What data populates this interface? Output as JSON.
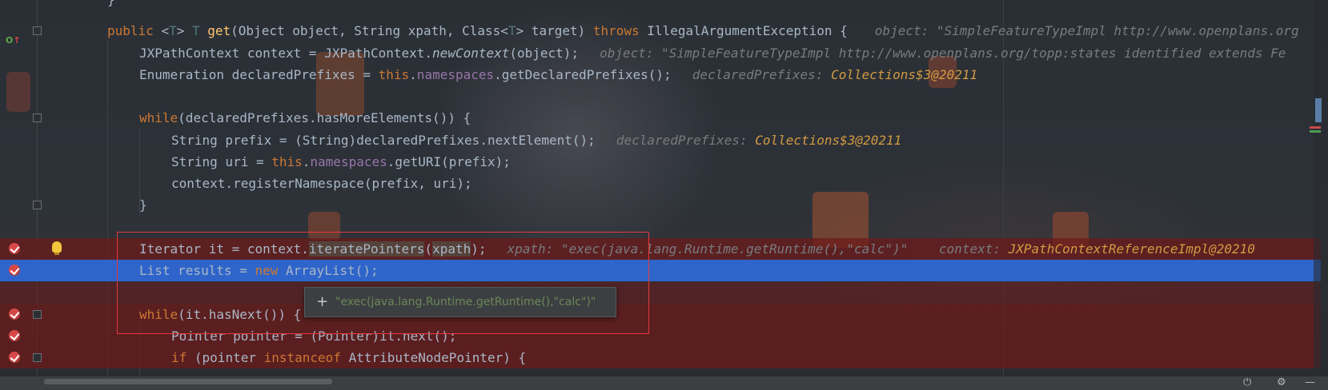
{
  "editor": {
    "lines": [
      {
        "tokens": [
          {
            "t": "public ",
            "c": "kw"
          },
          {
            "t": "<",
            "c": ""
          },
          {
            "t": "T",
            "c": "tp"
          },
          {
            "t": "> ",
            "c": ""
          },
          {
            "t": "T ",
            "c": "tp"
          },
          {
            "t": "get",
            "c": "fn"
          },
          {
            "t": "(Object object, String xpath, Class<",
            "c": ""
          },
          {
            "t": "T",
            "c": "tp"
          },
          {
            "t": "> target) ",
            "c": ""
          },
          {
            "t": "throws ",
            "c": "kw"
          },
          {
            "t": "IllegalArgumentException {",
            "c": ""
          }
        ],
        "hint": [
          {
            "t": "object: \"SimpleFeatureTypeImpl http://www.openplans.org",
            "c": "hint"
          }
        ]
      },
      {
        "tokens": [
          {
            "t": "JXPathContext context = JXPathContext.",
            "c": ""
          },
          {
            "t": "newContext",
            "c": "it"
          },
          {
            "t": "(object);",
            "c": ""
          }
        ],
        "hint": [
          {
            "t": "object: \"SimpleFeatureTypeImpl http://www.openplans.org/topp:states identified extends Fe",
            "c": "hint"
          }
        ]
      },
      {
        "tokens": [
          {
            "t": "Enumeration declaredPrefixes = ",
            "c": ""
          },
          {
            "t": "this",
            "c": "kw"
          },
          {
            "t": ".",
            "c": ""
          },
          {
            "t": "namespaces",
            "c": "fld"
          },
          {
            "t": ".getDeclaredPrefixes();",
            "c": ""
          }
        ],
        "hint": [
          {
            "t": "declaredPrefixes: ",
            "c": "hint"
          },
          {
            "t": "Collections$3@20211",
            "c": "hintv"
          }
        ]
      },
      {
        "tokens": [],
        "hint": []
      },
      {
        "tokens": [
          {
            "t": "while",
            "c": "kw"
          },
          {
            "t": "(declaredPrefixes.hasMoreElements()) {",
            "c": ""
          }
        ],
        "hint": []
      },
      {
        "tokens": [
          {
            "t": "String prefix = (String)declaredPrefixes.nextElement();",
            "c": ""
          }
        ],
        "hint": [
          {
            "t": "declaredPrefixes: ",
            "c": "hint"
          },
          {
            "t": "Collections$3@20211",
            "c": "hintv"
          }
        ]
      },
      {
        "tokens": [
          {
            "t": "String uri = ",
            "c": ""
          },
          {
            "t": "this",
            "c": "kw"
          },
          {
            "t": ".",
            "c": ""
          },
          {
            "t": "namespaces",
            "c": "fld"
          },
          {
            "t": ".getURI(prefix);",
            "c": ""
          }
        ],
        "hint": []
      },
      {
        "tokens": [
          {
            "t": "context.registerNamespace(prefix, uri);",
            "c": ""
          }
        ],
        "hint": []
      },
      {
        "tokens": [
          {
            "t": "}",
            "c": ""
          }
        ],
        "hint": []
      },
      {
        "tokens": [],
        "hint": []
      },
      {
        "tokens": [
          {
            "t": "Iterator it = context.",
            "c": ""
          },
          {
            "t": "iteratePointers",
            "c": "hl-ref"
          },
          {
            "t": "(",
            "c": ""
          },
          {
            "t": "xpath",
            "c": "hl-ref"
          },
          {
            "t": ");",
            "c": ""
          }
        ],
        "hint": [
          {
            "t": "xpath: \"exec(java.lang.Runtime.getRuntime(),\"calc\")\"    context: ",
            "c": "hint"
          },
          {
            "t": "JXPathContextReferenceImpl@20210",
            "c": "hintv"
          }
        ]
      },
      {
        "tokens": [
          {
            "t": "List results = ",
            "c": ""
          },
          {
            "t": "new ",
            "c": "kw"
          },
          {
            "t": "ArrayList();",
            "c": ""
          }
        ],
        "hint": []
      },
      {
        "tokens": [],
        "hint": []
      },
      {
        "tokens": [
          {
            "t": "while",
            "c": "kw"
          },
          {
            "t": "(it.hasNext()) {",
            "c": ""
          }
        ],
        "hint": []
      },
      {
        "tokens": [
          {
            "t": "Pointer pointer = (Pointer)it.next();",
            "c": ""
          }
        ],
        "hint": []
      },
      {
        "tokens": [
          {
            "t": "if ",
            "c": "kw"
          },
          {
            "t": "(pointer ",
            "c": ""
          },
          {
            "t": "instanceof ",
            "c": "kw"
          },
          {
            "t": "AttributeNodePointer) {",
            "c": ""
          }
        ],
        "hint": []
      }
    ],
    "top_fragment": "}"
  },
  "popup": {
    "plus_icon": "plus-icon",
    "value": "\"exec(java.lang.Runtime.getRuntime(),\"calc\")\""
  },
  "colors": {
    "keyword": "#cc7832",
    "method": "#ffc66d",
    "field": "#9876aa",
    "hint_value": "#d29a42",
    "selection": "#2f65ca",
    "breakpoint": "#d64848",
    "highlight_box": "#e0393e"
  }
}
